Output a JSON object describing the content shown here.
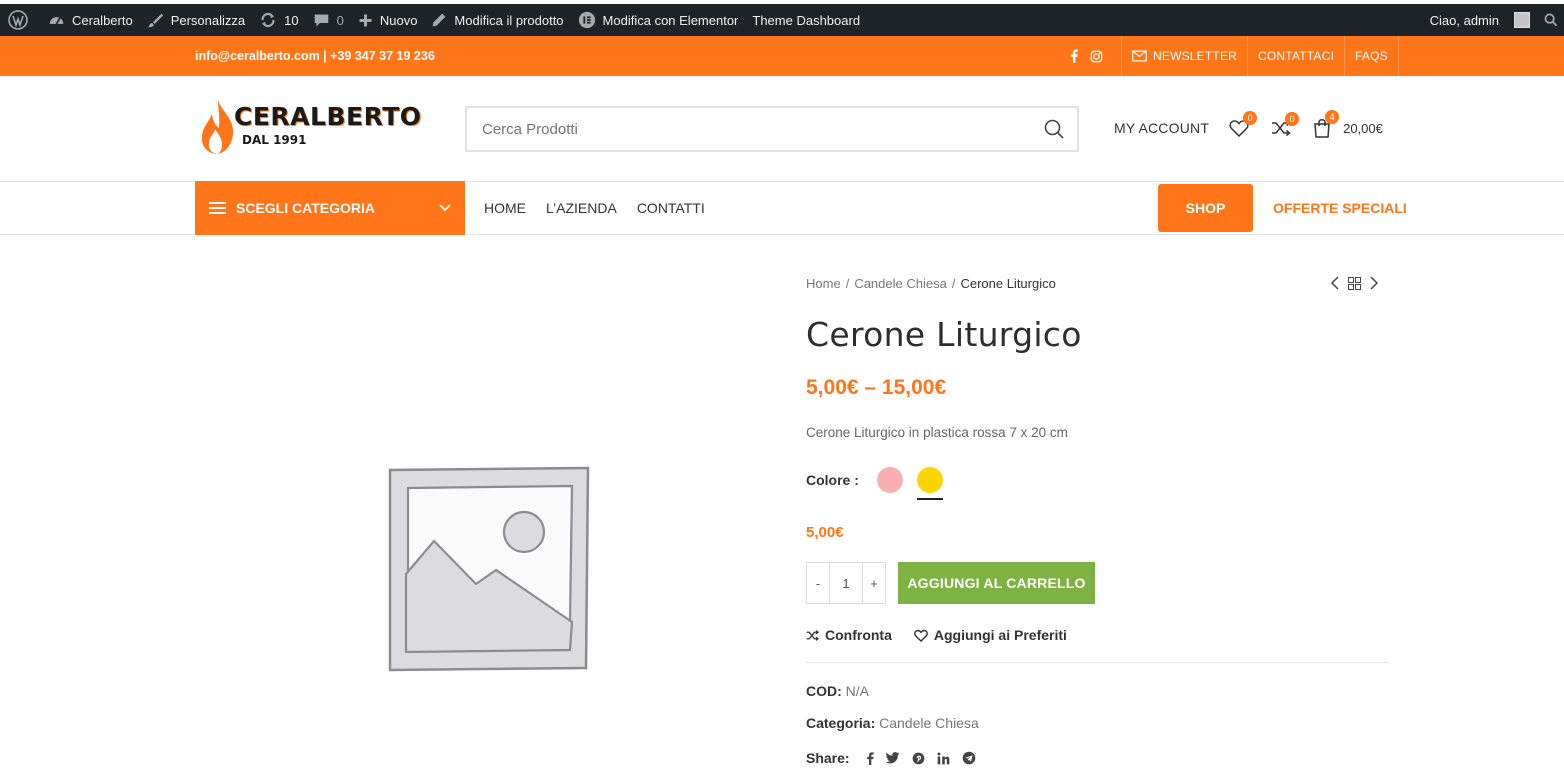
{
  "admin_bar": {
    "site_name": "Ceralberto",
    "customize": "Personalizza",
    "updates_count": "10",
    "comments_count": "0",
    "new": "Nuovo",
    "edit_product": "Modifica il prodotto",
    "edit_elementor": "Modifica con Elementor",
    "theme_dashboard": "Theme Dashboard",
    "greeting": "Ciao, admin"
  },
  "topbar": {
    "contact": "info@ceralberto.com | +39 347 37 19 236",
    "links": [
      "NEWSLETTER",
      "CONTATTACI",
      "FAQS"
    ]
  },
  "header": {
    "logo_name": "CERALBERTO",
    "logo_since": "DAL 1991",
    "search_placeholder": "Cerca Prodotti",
    "my_account": "MY ACCOUNT",
    "wishlist_count": "0",
    "compare_count": "0",
    "cart_count": "4",
    "cart_total": "20,00€"
  },
  "nav": {
    "category_button": "SCEGLI CATEGORIA",
    "menu": [
      "HOME",
      "L’AZIENDA",
      "CONTATTI"
    ],
    "shop": "SHOP",
    "offers": "OFFERTE SPECIALI"
  },
  "product": {
    "breadcrumb": [
      "Home",
      "Candele Chiesa",
      "Cerone Liturgico"
    ],
    "title": "Cerone Liturgico",
    "price_range": "5,00€ – 15,00€",
    "short_description": "Cerone Liturgico in plastica rossa 7 x 20 cm",
    "color_label": "Colore :",
    "swatches": [
      {
        "name": "pink",
        "color": "#f9aeb0",
        "selected": false
      },
      {
        "name": "yellow",
        "color": "#ffd400",
        "selected": true
      }
    ],
    "variation_price": "5,00€",
    "quantity": "1",
    "qty_minus": "-",
    "qty_plus": "+",
    "add_to_cart": "AGGIUNGI AL CARRELLO",
    "compare": "Confronta",
    "add_wishlist": "Aggiungi ai Preferiti",
    "sku_label": "COD:",
    "sku_value": "N/A",
    "category_label": "Categoria:",
    "category_value": "Candele Chiesa",
    "share_label": "Share:"
  },
  "colors": {
    "accent": "#ff7518",
    "admin_bar": "#1d2327",
    "add_to_cart": "#7cb342"
  }
}
